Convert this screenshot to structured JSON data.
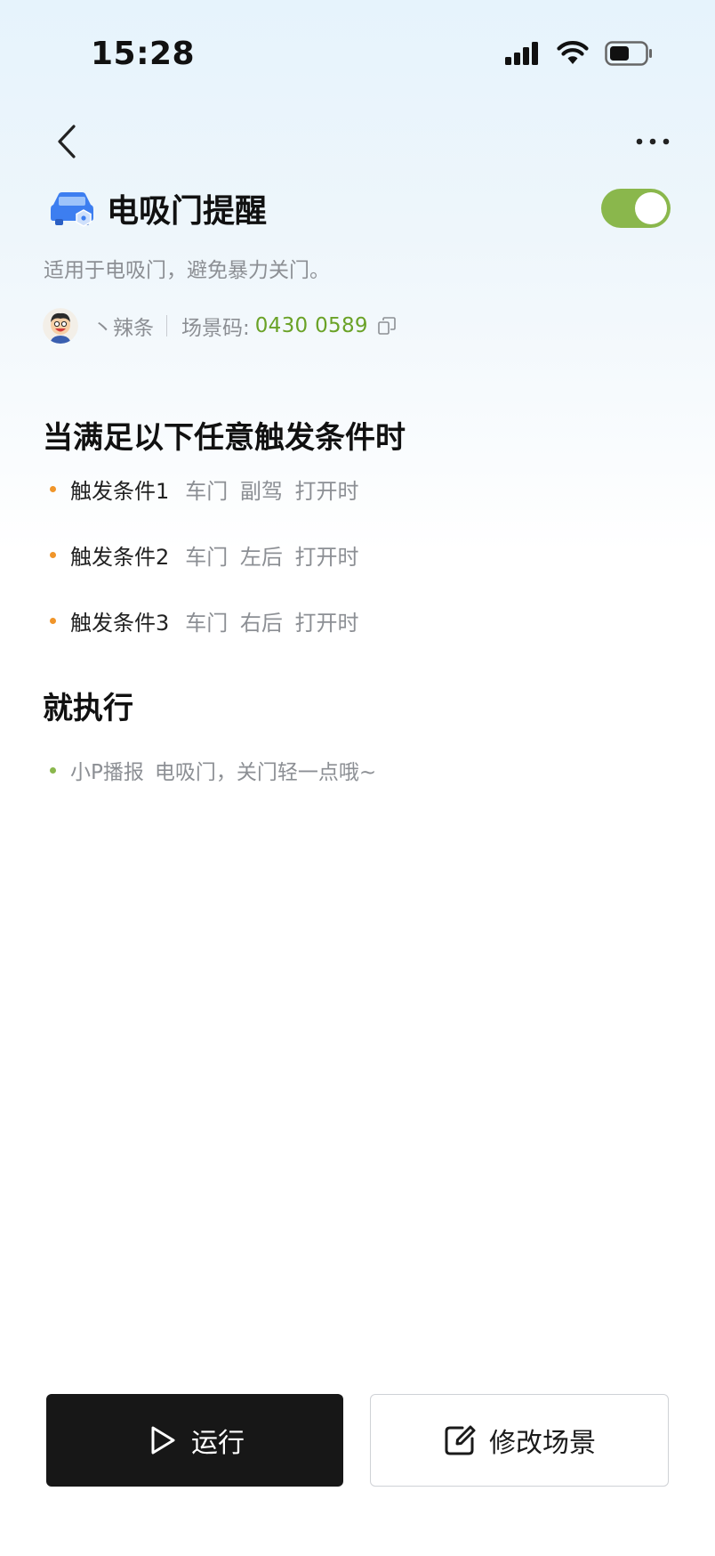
{
  "status_bar": {
    "time": "15:28"
  },
  "nav": {
    "back_icon": "chevron-left-icon",
    "more_icon": "more-horizontal-icon"
  },
  "scene": {
    "title": "电吸门提醒",
    "icon": "car-icon",
    "enabled": true,
    "toggle_color": "#8ab74c",
    "description": "适用于电吸门，避免暴力关门。",
    "author": "丶辣条",
    "code_label": "场景码:",
    "code_value": "0430 0589",
    "code_color": "#6aa227"
  },
  "conditions_section": {
    "title": "当满足以下任意触发条件时",
    "items": [
      {
        "name": "触发条件1",
        "detail": "车门 副驾 打开时"
      },
      {
        "name": "触发条件2",
        "detail": "车门 左后 打开时"
      },
      {
        "name": "触发条件3",
        "detail": "车门 右后 打开时"
      }
    ]
  },
  "execute_section": {
    "title": "就执行",
    "items": [
      {
        "name": "小P播报",
        "detail": "电吸门，关门轻一点哦~"
      }
    ]
  },
  "actions": {
    "run_label": "运行",
    "edit_label": "修改场景"
  }
}
